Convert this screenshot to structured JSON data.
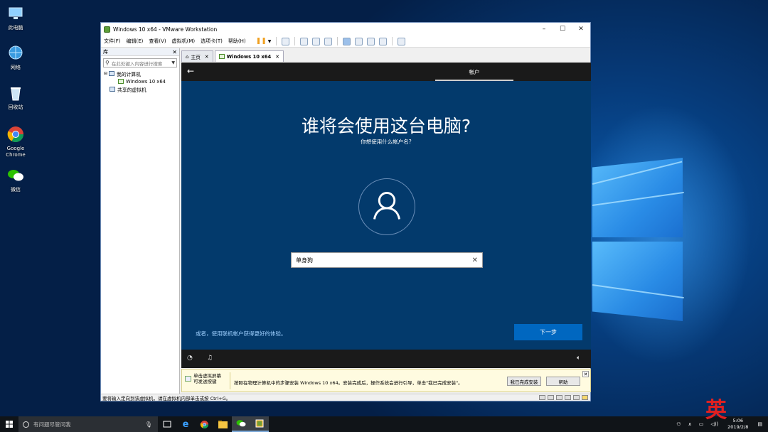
{
  "desktop": {
    "icons": [
      {
        "label": "此电脑",
        "icon": "this-pc-icon"
      },
      {
        "label": "网络",
        "icon": "network-icon"
      },
      {
        "label": "回收站",
        "icon": "recycle-bin-icon"
      },
      {
        "label": "Google\nChrome",
        "icon": "chrome-icon"
      },
      {
        "label": "微信",
        "icon": "wechat-icon"
      }
    ]
  },
  "vmware": {
    "title": "Windows 10 x64 - VMware Workstation",
    "menus": [
      "文件(F)",
      "编辑(E)",
      "查看(V)",
      "虚拟机(M)",
      "选项卡(T)",
      "帮助(H)"
    ],
    "library": {
      "header": "库",
      "search_placeholder": "在此处键入内容进行搜索",
      "tree": {
        "root": "我的计算机",
        "vm": "Windows 10 x64",
        "shared": "共享的虚拟机"
      }
    },
    "tabs": [
      {
        "label": "主页",
        "icon": "home-icon",
        "active": false
      },
      {
        "label": "Windows 10 x64",
        "icon": "vm-icon",
        "active": true
      }
    ],
    "guest": {
      "step_label": "帐户",
      "title": "谁将会使用这台电脑?",
      "subtitle": "你想使用什么帐户名?",
      "name_value": "单身狗",
      "alt_link": "或者，使用联机帐户获得更好的体验。",
      "next_label": "下一步"
    },
    "install_bar": {
      "hint": "单击虚拟屏幕\n可发送按键",
      "message": "按照在物理计算机中的步骤安装 Windows 10 x64。安装完成后，操作系统会进行引导，单击\"我已完成安装\"。",
      "done_label": "我已完成安装",
      "help_label": "帮助"
    },
    "status_text": "要将输入定向到该虚拟机，请在虚拟机内部单击或按 Ctrl+G。"
  },
  "taskbar": {
    "search_placeholder": "有问题尽管问我",
    "apps": [
      "task-view-icon",
      "edge-icon",
      "chrome-icon",
      "file-explorer-icon",
      "wechat-icon",
      "vmware-icon"
    ],
    "clock_time": "5:06",
    "clock_date": "2019/2/8",
    "ime": "英"
  }
}
